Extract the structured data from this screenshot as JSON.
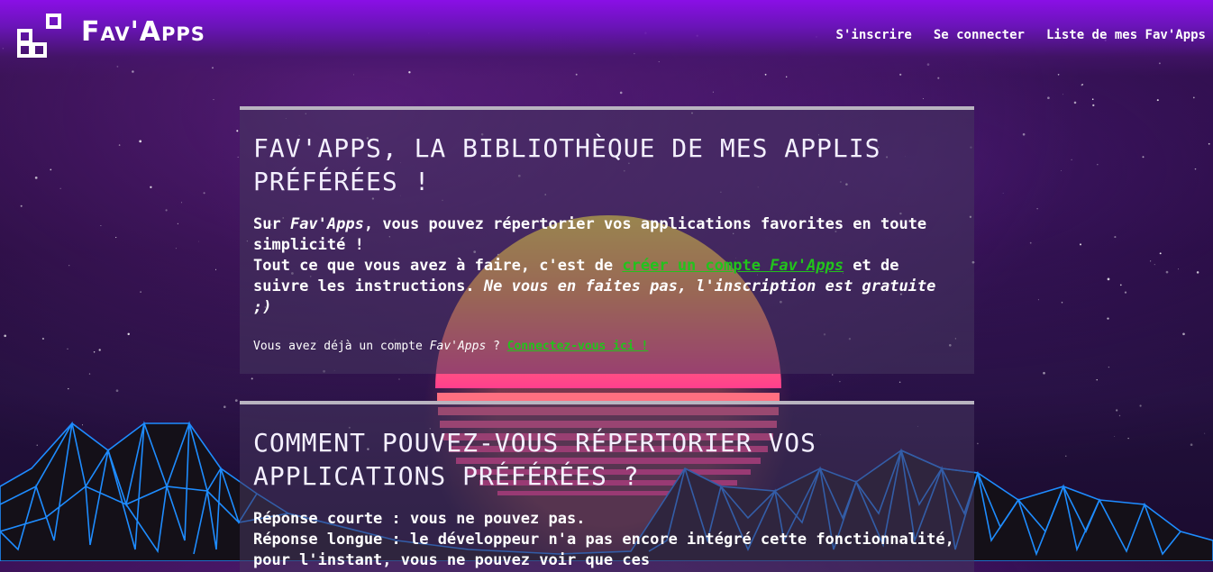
{
  "header": {
    "brand": "Fav'Apps",
    "nav": [
      {
        "label": "S'inscrire"
      },
      {
        "label": "Se connecter"
      },
      {
        "label": "Liste de mes Fav'Apps"
      }
    ]
  },
  "intro": {
    "title": "Fav'Apps, la bibliothèque de mes applis préférées !",
    "p1_prefix": "Sur ",
    "p1_brand": "Fav'Apps",
    "p1_text": ", vous pouvez répertorier vos applications favorites en toute simplicité !",
    "p2_prefix": "Tout ce que vous avez à faire, c'est de ",
    "p2_link": "créer un compte ",
    "p2_link_brand": "Fav'Apps",
    "p2_suffix": " et de suivre les instructions. ",
    "p2_italic": "Ne vous en faites pas, l'inscription est gratuite ;)",
    "small_prefix": "Vous avez déjà un compte ",
    "small_brand": "Fav'Apps",
    "small_mid": " ? ",
    "small_link": "Connectez-vous ici !"
  },
  "how": {
    "title": "Comment pouvez-vous répertorier vos applications préférées ?",
    "short": "Réponse courte : vous ne pouvez pas.",
    "long": "Réponse longue : le développeur n'a pas encore intégré cette fonctionnalité, pour l'instant, vous ne pouvez voir que ces"
  },
  "colors": {
    "header": "#8a0fe6",
    "link_green": "#22c31c",
    "grid_blue": "#1e8cff",
    "sun_top": "#ffe03a",
    "sun_bottom": "#ff3d8f"
  }
}
